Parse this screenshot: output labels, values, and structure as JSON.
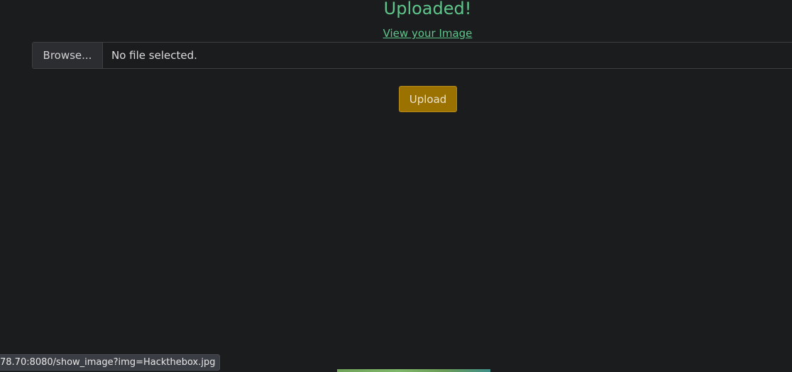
{
  "status": {
    "heading": "Uploaded!",
    "view_link": "View your Image"
  },
  "file_input": {
    "browse_label": "Browse...",
    "file_name": "No file selected."
  },
  "upload_button": {
    "label": "Upload"
  },
  "status_bar": {
    "url": "78.70:8080/show_image?img=Hackthebox.jpg"
  },
  "colors": {
    "background": "#1b1c1e",
    "success_text": "#5ec68b",
    "upload_button": "#9b7100"
  }
}
